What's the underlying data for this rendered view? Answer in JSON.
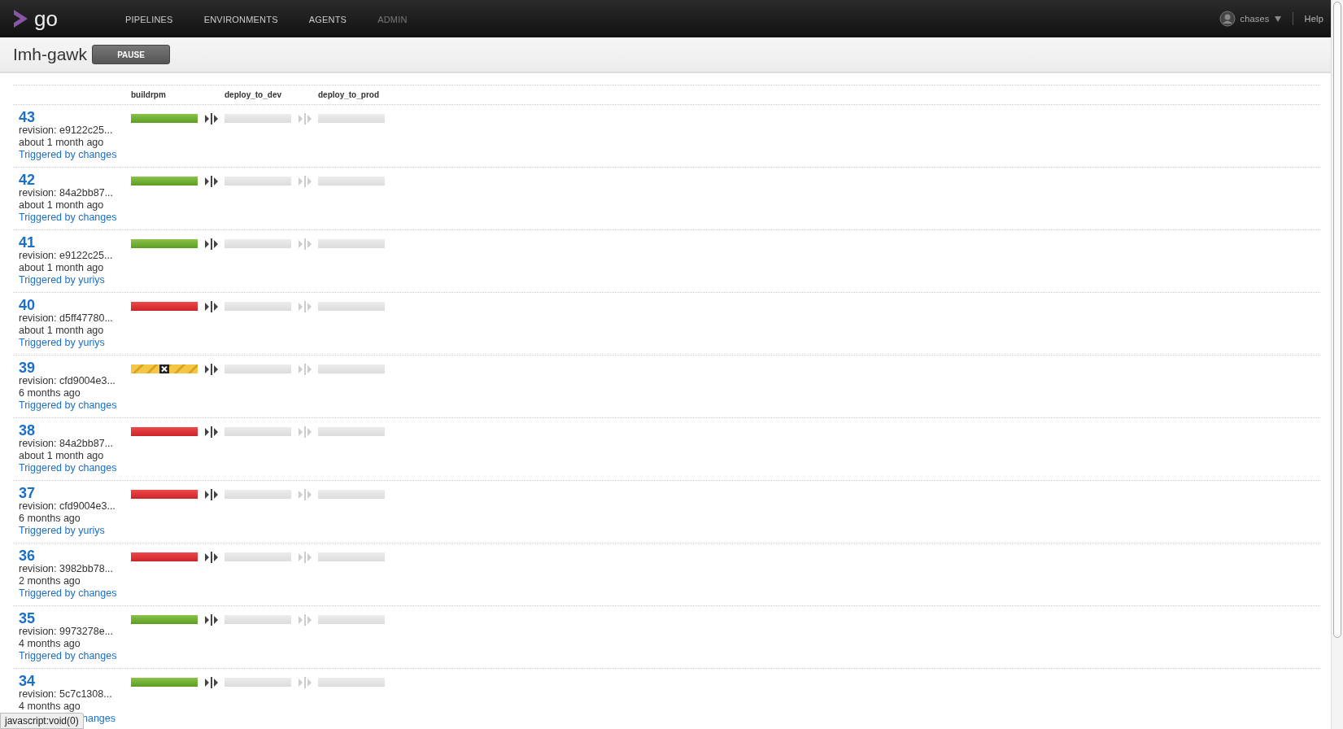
{
  "nav": {
    "logo": "go",
    "items": [
      {
        "label": "PIPELINES",
        "disabled": false
      },
      {
        "label": "ENVIRONMENTS",
        "disabled": false
      },
      {
        "label": "AGENTS",
        "disabled": false
      },
      {
        "label": "ADMIN",
        "disabled": true
      }
    ],
    "user": "chases",
    "help": "Help"
  },
  "pipeline": {
    "name": "Imh-gawk",
    "pause_button": "PAUSE"
  },
  "stages": [
    "buildrpm",
    "deploy_to_dev",
    "deploy_to_prod"
  ],
  "runs": [
    {
      "counter": "43",
      "revision": "revision: e9122c25...",
      "time": "about 1 month ago",
      "trigger": "Triggered by changes",
      "stages": [
        {
          "kind": "passed"
        },
        {
          "kind": "unrun"
        },
        {
          "kind": "unrun"
        }
      ]
    },
    {
      "counter": "42",
      "revision": "revision: 84a2bb87...",
      "time": "about 1 month ago",
      "trigger": "Triggered by changes",
      "stages": [
        {
          "kind": "passed"
        },
        {
          "kind": "unrun"
        },
        {
          "kind": "unrun"
        }
      ]
    },
    {
      "counter": "41",
      "revision": "revision: e9122c25...",
      "time": "about 1 month ago",
      "trigger": "Triggered by yuriys",
      "stages": [
        {
          "kind": "passed"
        },
        {
          "kind": "unrun"
        },
        {
          "kind": "unrun"
        }
      ]
    },
    {
      "counter": "40",
      "revision": "revision: d5ff47780...",
      "time": "about 1 month ago",
      "trigger": "Triggered by yuriys",
      "stages": [
        {
          "kind": "failed"
        },
        {
          "kind": "unrun"
        },
        {
          "kind": "unrun"
        }
      ]
    },
    {
      "counter": "39",
      "revision": "revision: cfd9004e3...",
      "time": "6 months ago",
      "trigger": "Triggered by changes",
      "stages": [
        {
          "kind": "cancelled"
        },
        {
          "kind": "unrun"
        },
        {
          "kind": "unrun"
        }
      ]
    },
    {
      "counter": "38",
      "revision": "revision: 84a2bb87...",
      "time": "about 1 month ago",
      "trigger": "Triggered by changes",
      "stages": [
        {
          "kind": "failed"
        },
        {
          "kind": "unrun"
        },
        {
          "kind": "unrun"
        }
      ]
    },
    {
      "counter": "37",
      "revision": "revision: cfd9004e3...",
      "time": "6 months ago",
      "trigger": "Triggered by yuriys",
      "stages": [
        {
          "kind": "failed"
        },
        {
          "kind": "unrun"
        },
        {
          "kind": "unrun"
        }
      ]
    },
    {
      "counter": "36",
      "revision": "revision: 3982bb78...",
      "time": "2 months ago",
      "trigger": "Triggered by changes",
      "stages": [
        {
          "kind": "failed"
        },
        {
          "kind": "unrun"
        },
        {
          "kind": "unrun"
        }
      ]
    },
    {
      "counter": "35",
      "revision": "revision: 9973278e...",
      "time": "4 months ago",
      "trigger": "Triggered by changes",
      "stages": [
        {
          "kind": "passed"
        },
        {
          "kind": "unrun"
        },
        {
          "kind": "unrun"
        }
      ]
    },
    {
      "counter": "34",
      "revision": "revision: 5c7c1308...",
      "time": "4 months ago",
      "trigger": "hanges",
      "trigger_covered": true,
      "stages": [
        {
          "kind": "passed"
        },
        {
          "kind": "unrun"
        },
        {
          "kind": "unrun"
        }
      ]
    }
  ],
  "status_bar": {
    "url": "javascript:void(0)"
  }
}
